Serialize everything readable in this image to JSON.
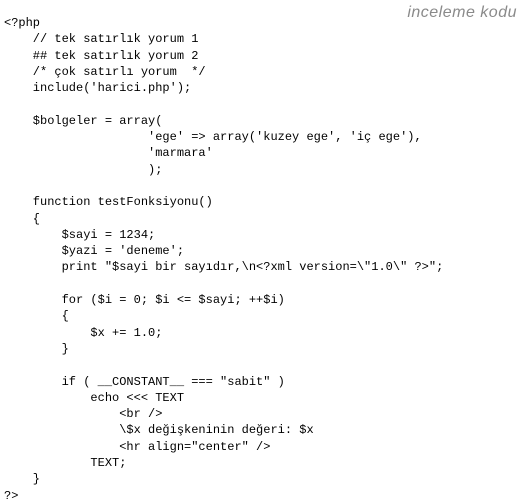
{
  "watermark": "inceleme kodu",
  "code_lines": [
    "<?php",
    "    // tek satırlık yorum 1",
    "    ## tek satırlık yorum 2",
    "    /* çok satırlı yorum  */",
    "    include('harici.php');",
    "",
    "    $bolgeler = array(",
    "                    'ege' => array('kuzey ege', 'iç ege'),",
    "                    'marmara'",
    "                    );",
    "",
    "    function testFonksiyonu()",
    "    {",
    "        $sayi = 1234;",
    "        $yazi = 'deneme';",
    "        print \"$sayi bir sayıdır,\\n<?xml version=\\\"1.0\\\" ?>\";",
    "",
    "        for ($i = 0; $i <= $sayi; ++$i)",
    "        {",
    "            $x += 1.0;",
    "        }",
    "",
    "        if ( __CONSTANT__ === \"sabit\" )",
    "            echo <<< TEXT",
    "                <br />",
    "                \\$x değişkeninin değeri: $x",
    "                <hr align=\"center\" />",
    "            TEXT;",
    "    }",
    "?>"
  ]
}
